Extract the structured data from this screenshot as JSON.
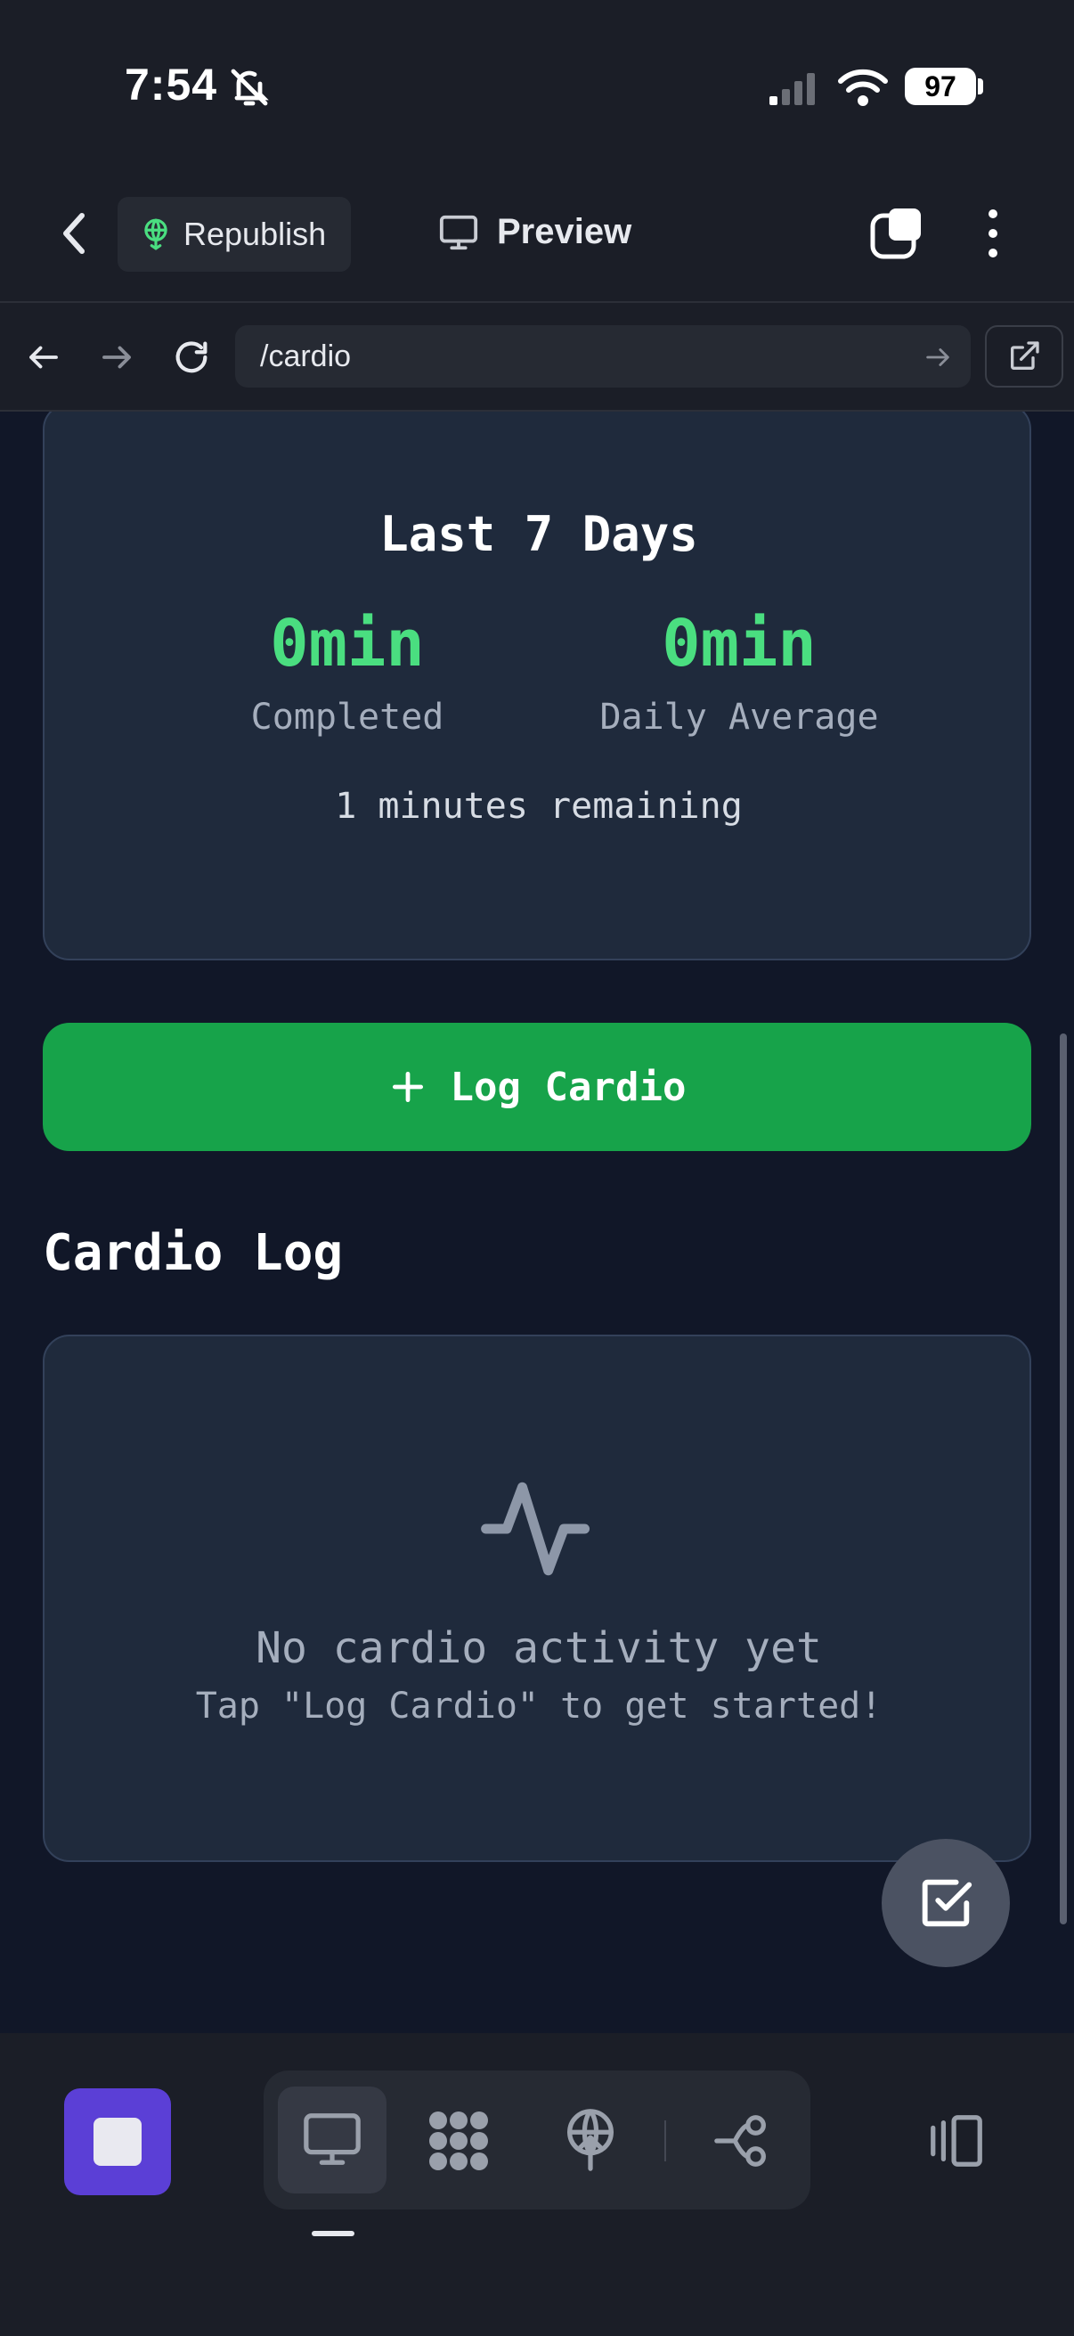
{
  "status_bar": {
    "time": "7:54",
    "battery": "97"
  },
  "toolbar": {
    "republish_label": "Republish",
    "preview_label": "Preview"
  },
  "url_bar": {
    "url": "/cardio"
  },
  "summary_card": {
    "title": "Last 7 Days",
    "completed_value": "0min",
    "completed_label": "Completed",
    "average_value": "0min",
    "average_label": "Daily Average",
    "remaining_text": "1 minutes remaining"
  },
  "log_button": {
    "label": "Log Cardio"
  },
  "log_section": {
    "title": "Cardio Log",
    "empty_title": "No cardio activity yet",
    "empty_hint": "Tap \"Log Cardio\" to get started!"
  },
  "colors": {
    "accent_green": "#4ade80",
    "button_green": "#17a34a",
    "stop_purple": "#5b3fd6",
    "content_bg": "#111728",
    "card_bg": "#1f2a3c"
  },
  "icons": [
    "bell-slash-icon",
    "signal-icon",
    "wifi-icon",
    "chevron-left-icon",
    "globe-icon",
    "monitor-icon",
    "tabs-icon",
    "more-vertical-icon",
    "arrow-left-icon",
    "arrow-right-icon",
    "refresh-icon",
    "external-link-icon",
    "plus-icon",
    "activity-icon",
    "check-square-icon",
    "stop-icon",
    "desktop-icon",
    "dots-grid-icon",
    "publish-icon",
    "connections-icon",
    "side-panel-icon"
  ]
}
